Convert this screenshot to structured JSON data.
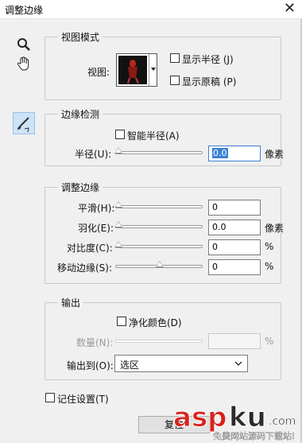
{
  "window": {
    "title": "调整边缘",
    "close_glyph": "✕"
  },
  "tools": [
    "magnifier-icon",
    "hand-icon",
    "refine-radius-brush-icon"
  ],
  "view_mode": {
    "legend": "视图模式",
    "view_label": "视图:",
    "show_radius_label": "显示半径 (J)",
    "show_original_label": "显示原稿 (P)",
    "show_radius_checked": false,
    "show_original_checked": false
  },
  "edge_detection": {
    "legend": "边缘检测",
    "smart_radius_label": "智能半径(A)",
    "smart_radius_checked": false,
    "radius_label": "半径(U):",
    "radius_value": "0.0",
    "radius_unit": "像素",
    "radius_level": 0
  },
  "adjust_edge": {
    "legend": "调整边缘",
    "rows": [
      {
        "label": "平滑(H):",
        "value": "0",
        "unit": "",
        "level": 0
      },
      {
        "label": "羽化(E):",
        "value": "0.0",
        "unit": "像素",
        "level": 0
      },
      {
        "label": "对比度(C):",
        "value": "0",
        "unit": "%",
        "level": 0
      },
      {
        "label": "移动边缘(S):",
        "value": "0",
        "unit": "%",
        "level": 0.5
      }
    ]
  },
  "output": {
    "legend": "输出",
    "decontaminate_label": "净化颜色(D)",
    "decontaminate_checked": false,
    "amount_label": "数量(N):",
    "amount_unit": "%",
    "output_to_label": "输出到(O):",
    "output_to_value": "选区"
  },
  "remember_settings_label": "记住设置(T)",
  "remember_settings_checked": false,
  "bottom_button_label": "复位",
  "watermark": {
    "brand": "aspku",
    "tld": ".com",
    "tagline": "免费网站源码下载站!"
  }
}
